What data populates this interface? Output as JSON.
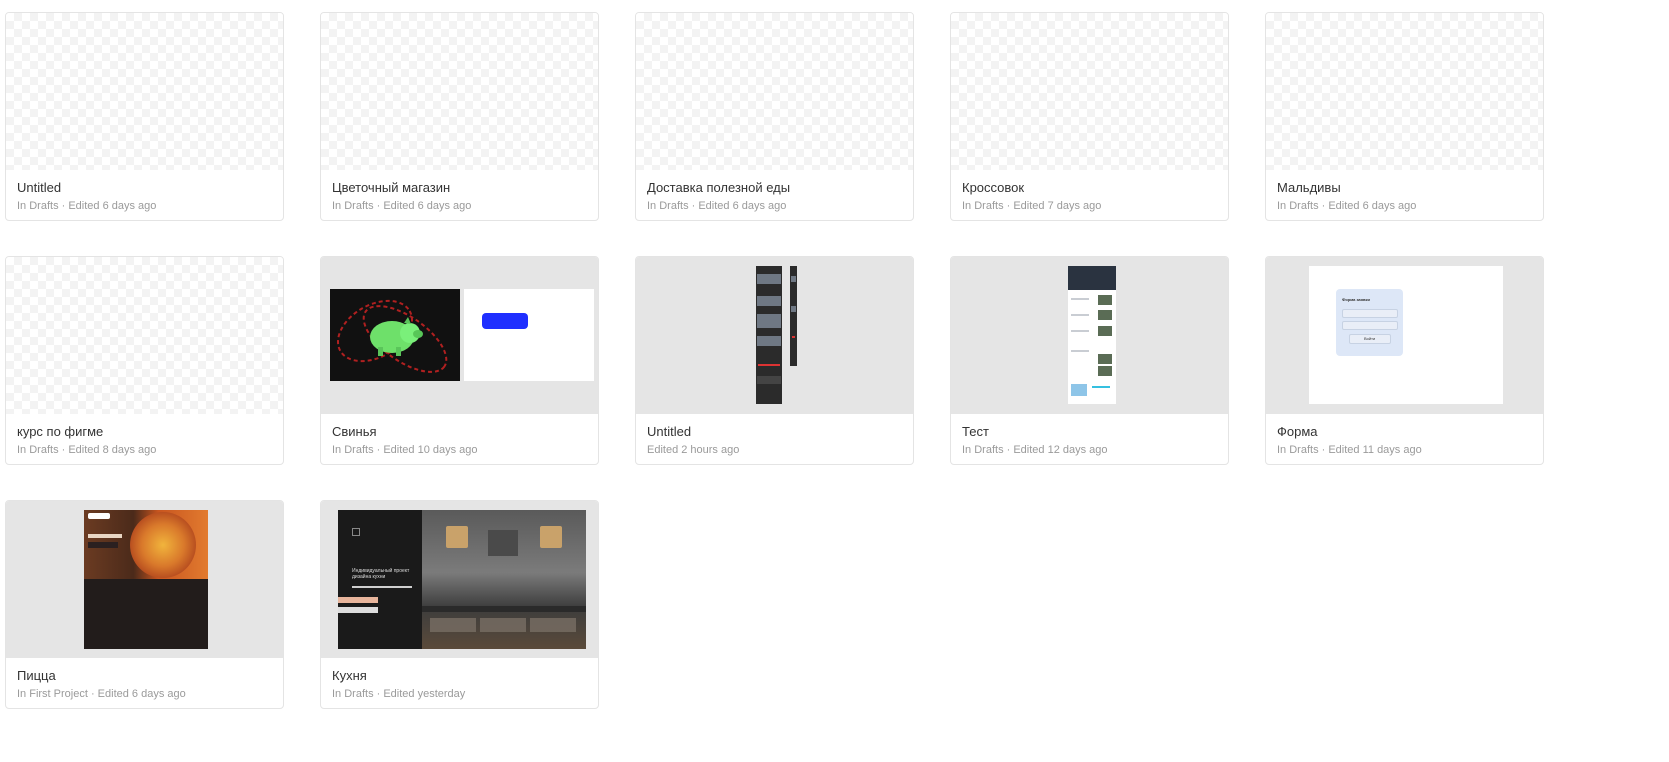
{
  "files": [
    {
      "title": "Untitled",
      "meta": "In Drafts · Edited 6 days ago"
    },
    {
      "title": "Цветочный магазин",
      "meta": "In Drafts · Edited 6 days ago"
    },
    {
      "title": "Доставка полезной еды",
      "meta": "In Drafts · Edited 6 days ago"
    },
    {
      "title": "Кроссовок",
      "meta": "In Drafts · Edited 7 days ago"
    },
    {
      "title": "Мальдивы",
      "meta": "In Drafts · Edited 6 days ago"
    },
    {
      "title": "курс по фигме",
      "meta": "In Drafts · Edited 8 days ago"
    },
    {
      "title": "Свинья",
      "meta": "In Drafts · Edited 10 days ago"
    },
    {
      "title": "Untitled",
      "meta": "Edited 2 hours ago"
    },
    {
      "title": "Тест",
      "meta": "In Drafts · Edited 12 days ago"
    },
    {
      "title": "Форма",
      "meta": "In Drafts · Edited 11 days ago"
    },
    {
      "title": "Пицца",
      "meta": "In First Project · Edited 6 days ago"
    },
    {
      "title": "Кухня",
      "meta": "In Drafts · Edited yesterday"
    }
  ],
  "thumb_text": {
    "form_title": "Форма заявки",
    "form_button": "Войти",
    "kitchen_heading": "Индивидуальный проект дизайна кухни"
  },
  "colors": {
    "card_border": "#e4e4e4",
    "title_text": "#333333",
    "meta_text": "#9a9a9a",
    "thumb_gray": "#e5e5e5",
    "pig_button": "#1f2fff"
  }
}
